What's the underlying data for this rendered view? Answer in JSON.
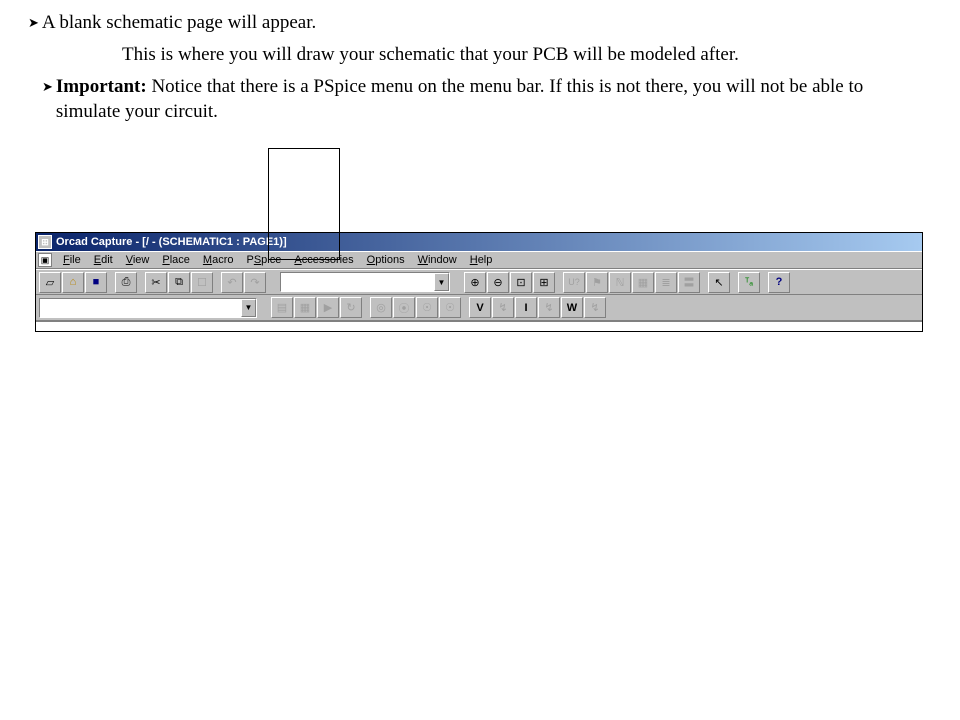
{
  "doc": {
    "b1_text": "A blank schematic page will appear.",
    "b2_text": "This is where you will draw your schematic that your PCB will be modeled after.",
    "b3_strong": "Important:",
    "b3_rest": " Notice that there is a PSpice menu on the menu bar.  If this is not there, you will not be able to simulate your circuit."
  },
  "app": {
    "title": "Orcad Capture - [/ - (SCHEMATIC1 : PAGE1)]",
    "menus": [
      "File",
      "Edit",
      "View",
      "Place",
      "Macro",
      "PSpice",
      "Accessories",
      "Options",
      "Window",
      "Help"
    ],
    "toolbar1": {
      "icons": [
        "□",
        "☞",
        "▤",
        "",
        "⎙",
        "",
        "✂",
        "⧉",
        "📋",
        "",
        "↶",
        "↷",
        "",
        "",
        "",
        "",
        "",
        "",
        ""
      ],
      "right_icons": [
        "⊕",
        "⊖",
        "⊡",
        "⊞",
        "",
        "U?",
        "✎",
        "✓",
        "▦",
        "☰",
        "〓",
        "",
        "↖",
        "",
        "ᵀₐ",
        "",
        "?"
      ]
    },
    "toolbar2": {
      "icons": [
        "▤",
        "▦",
        "▶",
        "↻",
        "",
        "◎",
        "⦿",
        "☉",
        "☉",
        "",
        "V",
        "↯",
        "I",
        "↯",
        "W",
        "↯"
      ]
    }
  }
}
